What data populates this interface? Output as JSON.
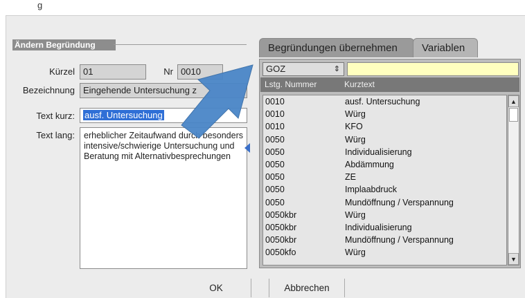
{
  "top_strip": {
    "text": "g"
  },
  "group": {
    "title": "Ändern Begründung"
  },
  "form": {
    "kuerzel_label": "Kürzel",
    "kuerzel_value": "01",
    "nr_label": "Nr",
    "nr_value": "0010",
    "bezeichnung_label": "Bezeichnung",
    "bezeichnung_value": "Eingehende Untersuchung z",
    "textkurz_label": "Text kurz:",
    "textkurz_value": "ausf. Untersuchung",
    "textlang_label": "Text lang:",
    "textlang_value": "erheblicher Zeitaufwand durch besonders intensive/schwierige Untersuchung und Beratung mit Alternativbesprechungen"
  },
  "tabs": [
    {
      "label": "Begründungen übernehmen",
      "active": true
    },
    {
      "label": "Variablen",
      "active": false
    }
  ],
  "catalog_select": {
    "value": "GOZ"
  },
  "search_input": {
    "value": ""
  },
  "table": {
    "headers": [
      "Lstg. Nummer",
      "Kurztext"
    ],
    "rows": [
      [
        "0010",
        "ausf. Untersuchung"
      ],
      [
        "0010",
        "Würg"
      ],
      [
        "0010",
        "KFO"
      ],
      [
        "0050",
        "Würg"
      ],
      [
        "0050",
        "Individualisierung"
      ],
      [
        "0050",
        "Abdämmung"
      ],
      [
        "0050",
        "ZE"
      ],
      [
        "0050",
        "Implaabdruck"
      ],
      [
        "0050",
        "Mundöffnung / Verspannung"
      ],
      [
        "0050kbr",
        "Würg"
      ],
      [
        "0050kbr",
        "Individualisierung"
      ],
      [
        "0050kbr",
        "Mundöffnung / Verspannung"
      ],
      [
        "0050kfo",
        "Würg"
      ]
    ]
  },
  "buttons": {
    "ok": "OK",
    "cancel": "Abbrechen"
  },
  "colors": {
    "highlight": "#2f6fd6",
    "arrow": "#4a86c8",
    "search_bg": "#ffffbf"
  }
}
